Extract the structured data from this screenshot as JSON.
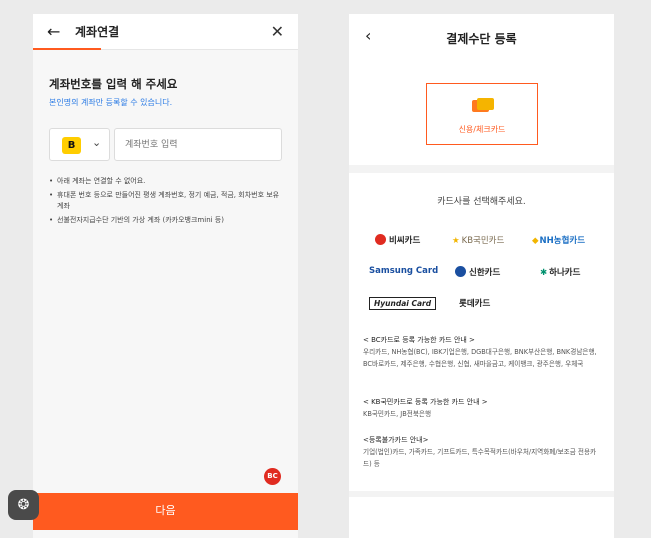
{
  "left_screen": {
    "header_title": "계좌연결",
    "heading": "계좌번호를 입력 해 주세요",
    "subheading": "본인명의 계좌만 등록할 수 있습니다.",
    "bank_logo_text": "B",
    "account_placeholder": "계좌번호 입력",
    "notes": [
      "아래 계좌는 연결할 수 없어요.",
      "휴대폰 번호 등으로 만들어진 평생 계좌번호, 정기 예금, 적금, 회차번호 보유계좌",
      "선불전자지급수단 기반의 가상 계좌 (카카오뱅크mini 등)"
    ],
    "badge_text": "BC",
    "next_label": "다음",
    "accent_color": "#ff5a1f",
    "float_icon": "brain-icon"
  },
  "right_screen": {
    "header_title": "결제수단 등록",
    "card_option_label": "신용/체크카드",
    "pick_issuer_label": "카드사를 선택해주세요.",
    "issuers": [
      {
        "name": "비씨카드",
        "color": "#e02b20"
      },
      {
        "name": "KB국민카드",
        "color": "#7a6a4f"
      },
      {
        "name": "NH농협카드",
        "color": "#1b6fc4"
      },
      {
        "name": "Samsung Card",
        "color": "#1a4fa0"
      },
      {
        "name": "신한카드",
        "color": "#222222"
      },
      {
        "name": "하나카드",
        "color": "#222222"
      },
      {
        "name": "Hyundai Card",
        "color": "#222222"
      },
      {
        "name": "롯데카드",
        "color": "#222222"
      }
    ],
    "sections": [
      {
        "heading": "< BC카드로 등록 가능한 카드 안내 >",
        "body": "우리카드, NH농협(BC), IBK기업은행, DGB대구은행, BNK부산은행, BNK경남은행, BC바로카드, 제주은행, 수협은행, 신협, 새마을금고, 케이뱅크, 광주은행, 우체국"
      },
      {
        "heading": "< KB국민카드로 등록 가능한 카드 안내 >",
        "body": "KB국민카드, JB전북은행"
      },
      {
        "heading": "<등록불가카드 안내>",
        "body": "기업(법인)카드, 가족카드, 기프트카드, 특수목적카드(바우처/지역화폐/보조금 전용카드) 등"
      }
    ]
  }
}
